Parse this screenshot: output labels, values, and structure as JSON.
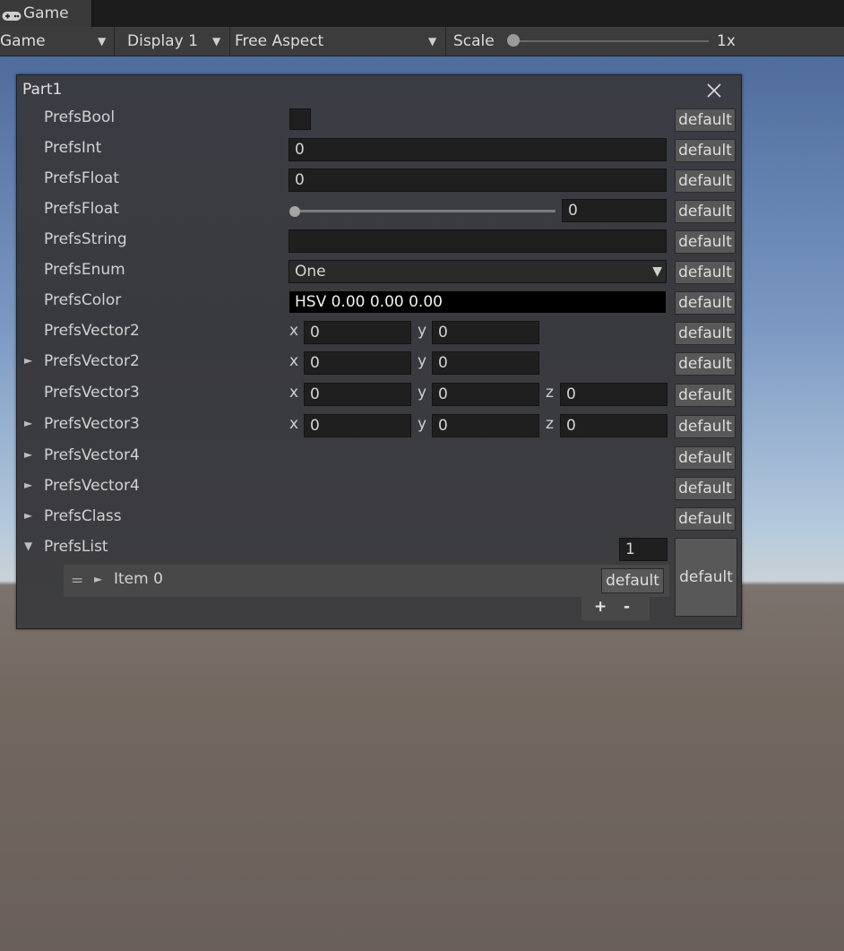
{
  "tab": {
    "icon": "gamepad-icon",
    "label": "Game"
  },
  "toolbar": {
    "mode": "Game",
    "display": "Display 1",
    "aspect": "Free Aspect",
    "scale_label": "Scale",
    "scale_value": "1x"
  },
  "window": {
    "title": "Part1"
  },
  "rows": {
    "bool": {
      "label": "PrefsBool"
    },
    "int": {
      "label": "PrefsInt",
      "value": "0"
    },
    "float": {
      "label": "PrefsFloat",
      "value": "0"
    },
    "float_slider": {
      "label": "PrefsFloat",
      "value": "0",
      "slider_fraction": 0
    },
    "string": {
      "label": "PrefsString",
      "value": ""
    },
    "enum": {
      "label": "PrefsEnum",
      "value": "One"
    },
    "color": {
      "label": "PrefsColor",
      "value": "HSV 0.00 0.00 0.00"
    },
    "vec2a": {
      "label": "PrefsVector2",
      "x": "0",
      "y": "0"
    },
    "vec2b": {
      "label": "PrefsVector2",
      "x": "0",
      "y": "0"
    },
    "vec3a": {
      "label": "PrefsVector3",
      "x": "0",
      "y": "0",
      "z": "0"
    },
    "vec3b": {
      "label": "PrefsVector3",
      "x": "0",
      "y": "0",
      "z": "0"
    },
    "vec4a": {
      "label": "PrefsVector4"
    },
    "vec4b": {
      "label": "PrefsVector4"
    },
    "class": {
      "label": "PrefsClass"
    },
    "list": {
      "label": "PrefsList",
      "count": "1"
    }
  },
  "axis": {
    "x": "x",
    "y": "y",
    "z": "z"
  },
  "default_label": "default",
  "list_item": {
    "handle": "=",
    "label": "Item 0"
  },
  "list_footer": {
    "plus": "+",
    "minus": "-"
  },
  "glyphs": {
    "dropdown": "▼",
    "fold_closed": "►",
    "fold_open": "▼"
  },
  "colors": {
    "toolbar": "#3c3c3c",
    "window": "#393a3f",
    "field": "#1f1f1f",
    "button": "#585858"
  }
}
